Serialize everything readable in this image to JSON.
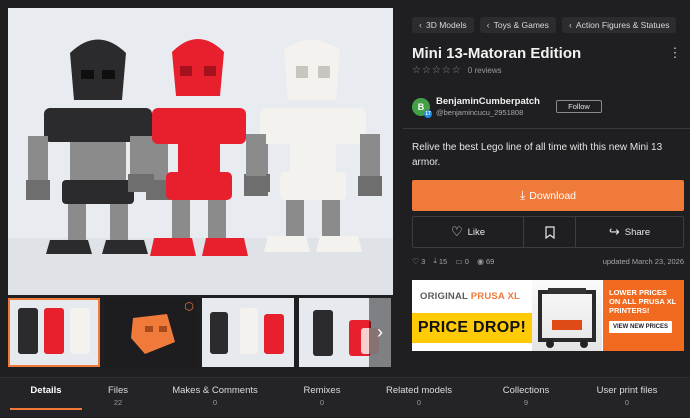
{
  "breadcrumbs": [
    "3D Models",
    "Toys & Games",
    "Action Figures & Statues"
  ],
  "model": {
    "title": "Mini 13-Matoran Edition",
    "reviews": "0 reviews",
    "description": "Relive the best Lego line of all time with this new Mini 13 armor."
  },
  "author": {
    "avatar_letter": "B",
    "badge": "17",
    "name": "BenjaminCumberpatch",
    "handle": "@benjamincucu_2951808",
    "follow_label": "Follow"
  },
  "actions": {
    "download": "Download",
    "like": "Like",
    "share": "Share"
  },
  "stats": {
    "likes": "3",
    "downloads": "15",
    "comments": "0",
    "views": "69",
    "updated": "updated March 23, 2026"
  },
  "ad": {
    "brand_line": "ORIGINAL",
    "brand_name": "PRUSA XL",
    "price_drop": "PRICE DROP!",
    "right_text": "LOWER PRICES ON ALL PRUSA XL PRINTERS!",
    "cta": "VIEW NEW PRICES"
  },
  "tabs": [
    {
      "label": "Details",
      "count": ""
    },
    {
      "label": "Files",
      "count": "22"
    },
    {
      "label": "Makes & Comments",
      "count": "0"
    },
    {
      "label": "Remixes",
      "count": "0"
    },
    {
      "label": "Related models",
      "count": "0"
    },
    {
      "label": "Collections",
      "count": "9"
    },
    {
      "label": "User print files",
      "count": "0"
    }
  ],
  "colors": {
    "accent": "#f07a3a",
    "background": "#1f1f22",
    "figure_black": "#2b2b2e",
    "figure_red": "#e8202e",
    "figure_white": "#f4f2ee",
    "limb_gray": "#8b8b8b"
  },
  "icons": [
    "chevron-left-icon",
    "star-outline-icon",
    "download-icon",
    "heart-icon",
    "bookmark-icon",
    "share-icon",
    "cube-icon",
    "chevron-right-icon"
  ]
}
